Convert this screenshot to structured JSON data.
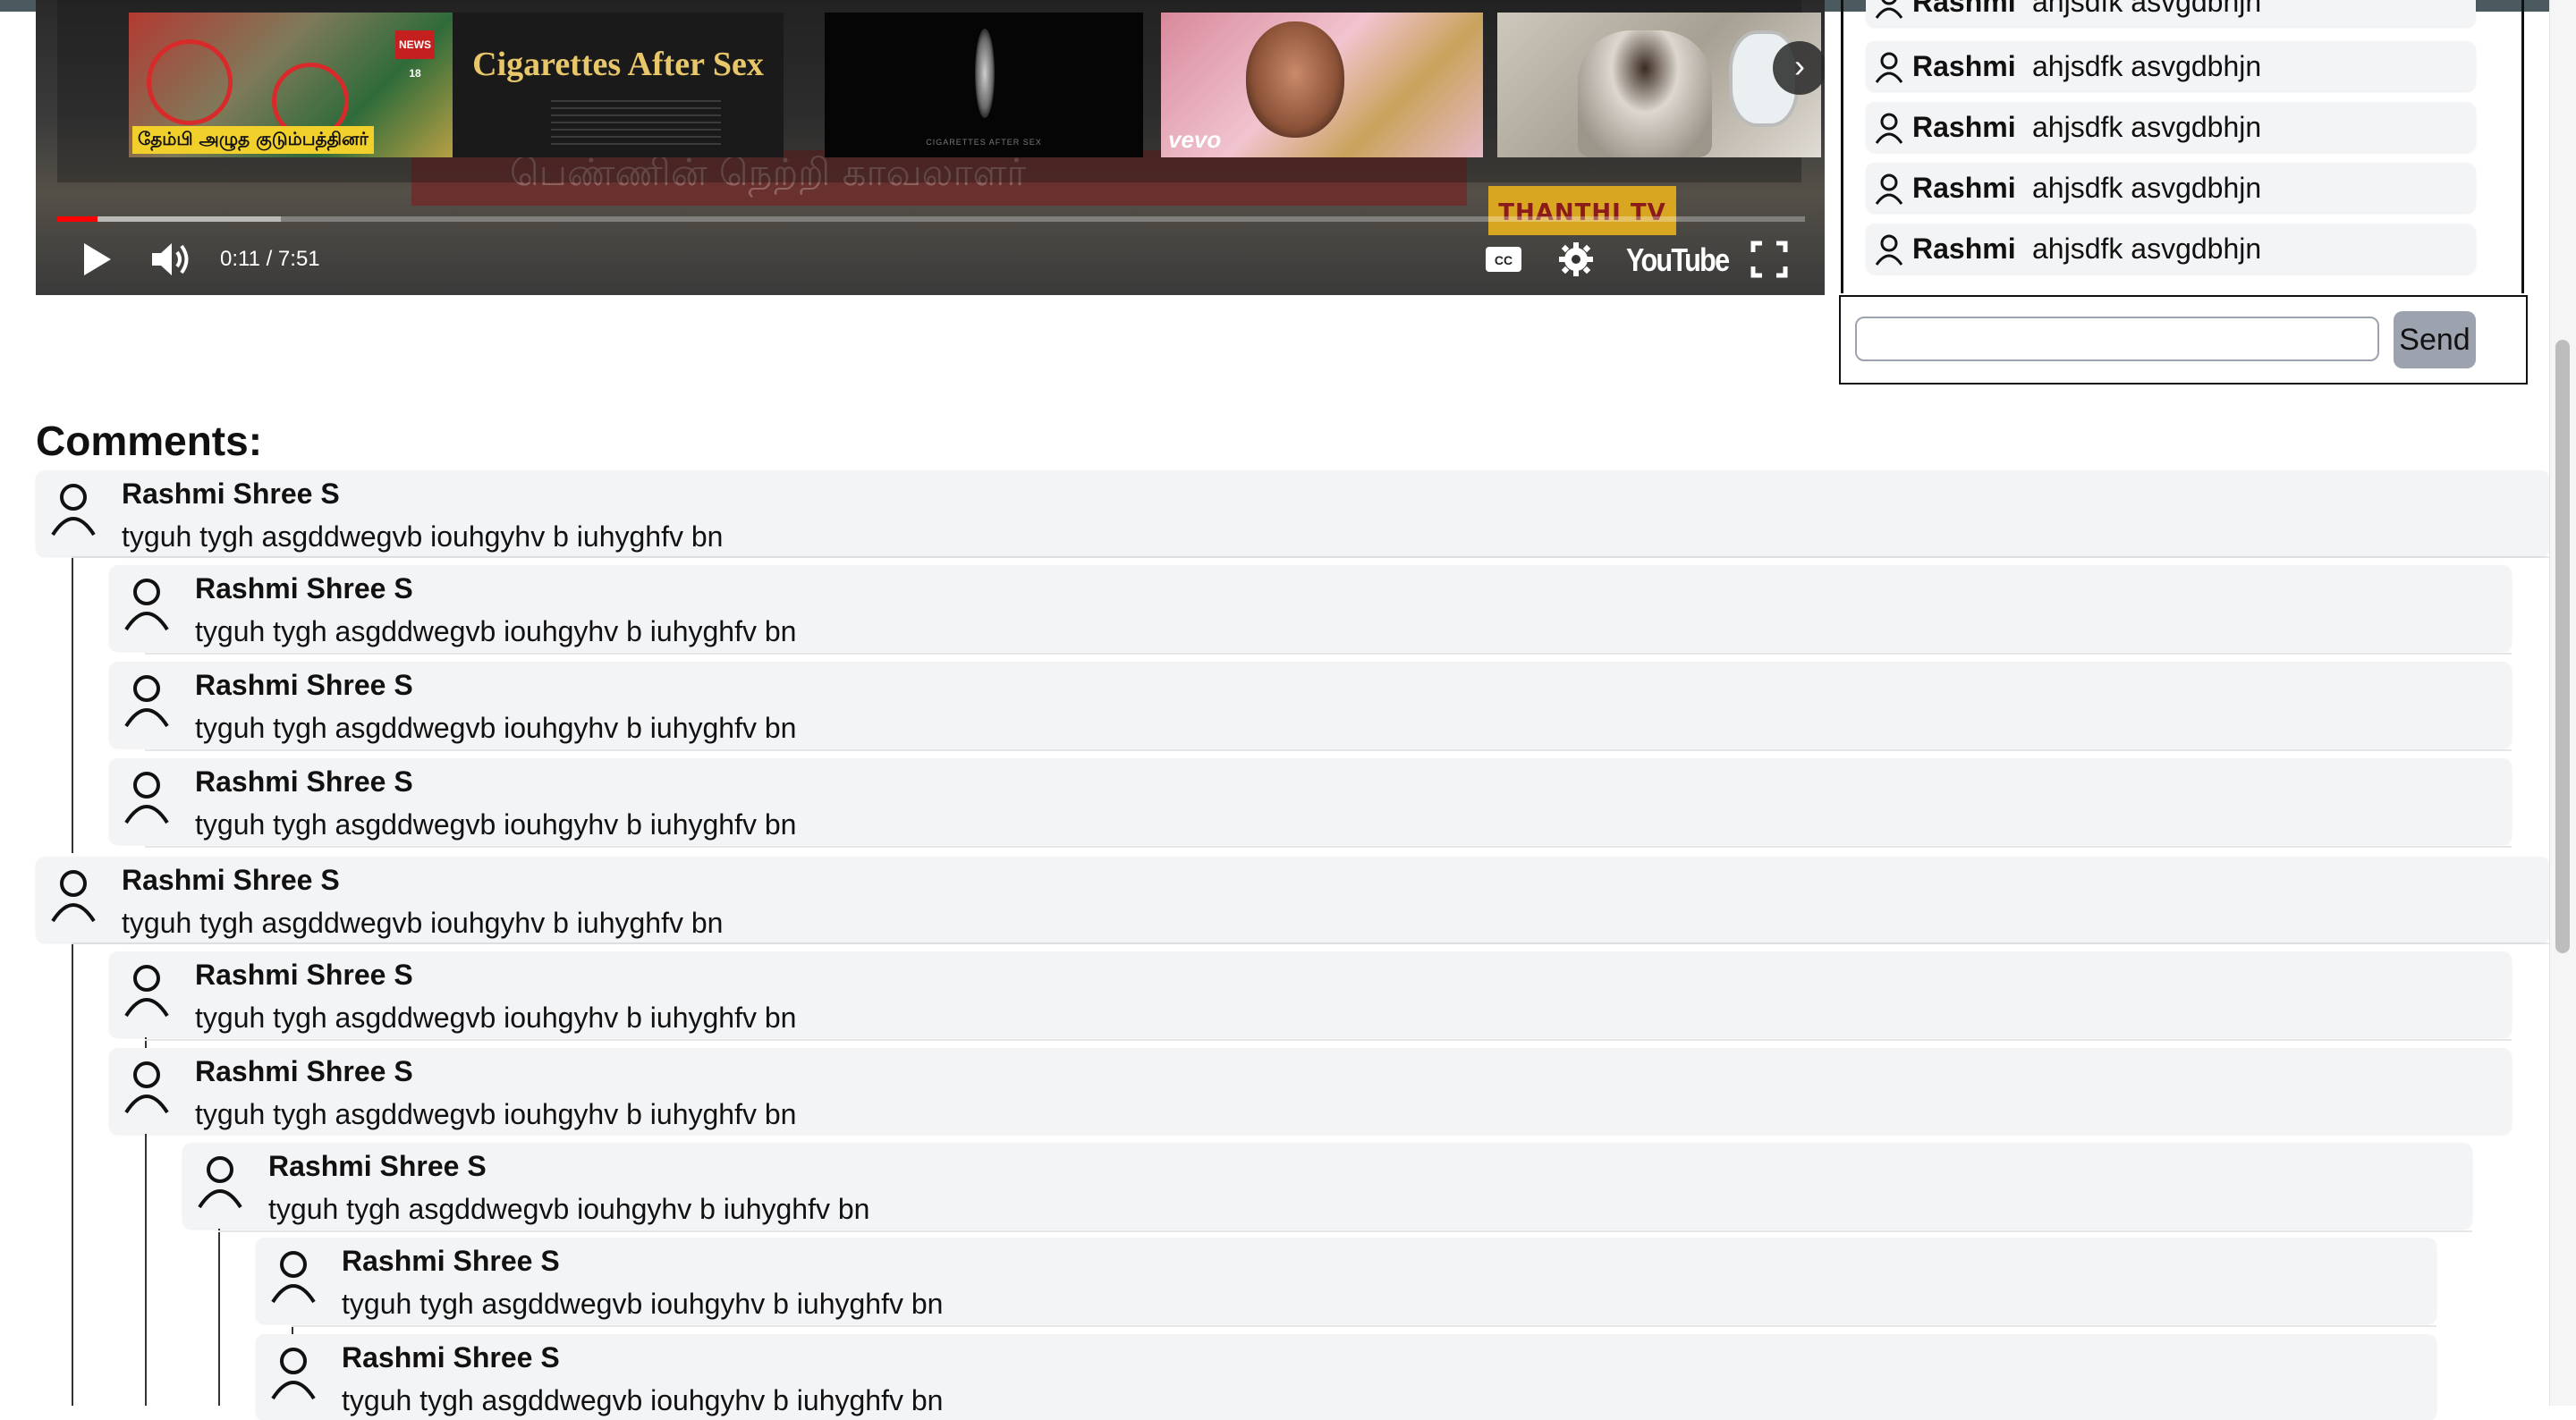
{
  "player": {
    "background_overlay_text": "பெண்ணின் நெற்றி காவலாளர்",
    "badge": "THANTHI TV",
    "endscreen": {
      "thumb1_label": "தேம்பி அழுத குடும்பத்தினர்",
      "thumb1_logo": "NEWS 18",
      "thumb2_title": "Cigarettes After Sex",
      "thumb3_caption": "CIGARETTES AFTER SEX",
      "thumb4_label": "vevo"
    },
    "progress_fraction": 0.023,
    "loaded_fraction": 0.128,
    "time_display": "0:11 / 7:51",
    "brand": "YouTube"
  },
  "chat": {
    "messages": [
      {
        "user": "Rashmi",
        "text": "ahjsdfk asvgdbhjn"
      },
      {
        "user": "Rashmi",
        "text": "ahjsdfk asvgdbhjn"
      },
      {
        "user": "Rashmi",
        "text": "ahjsdfk asvgdbhjn"
      },
      {
        "user": "Rashmi",
        "text": "ahjsdfk asvgdbhjn"
      },
      {
        "user": "Rashmi",
        "text": "ahjsdfk asvgdbhjn"
      }
    ],
    "input_value": "",
    "send_label": "Send"
  },
  "comments": {
    "title": "Comments:",
    "items": [
      {
        "author": "Rashmi Shree S",
        "text": "tyguh tygh asgddwegvb iouhgyhv b iuhyghfv bn"
      },
      {
        "author": "Rashmi Shree S",
        "text": "tyguh tygh asgddwegvb iouhgyhv b iuhyghfv bn"
      },
      {
        "author": "Rashmi Shree S",
        "text": "tyguh tygh asgddwegvb iouhgyhv b iuhyghfv bn"
      },
      {
        "author": "Rashmi Shree S",
        "text": "tyguh tygh asgddwegvb iouhgyhv b iuhyghfv bn"
      },
      {
        "author": "Rashmi Shree S",
        "text": "tyguh tygh asgddwegvb iouhgyhv b iuhyghfv bn"
      },
      {
        "author": "Rashmi Shree S",
        "text": "tyguh tygh asgddwegvb iouhgyhv b iuhyghfv bn"
      },
      {
        "author": "Rashmi Shree S",
        "text": "tyguh tygh asgddwegvb iouhgyhv b iuhyghfv bn"
      },
      {
        "author": "Rashmi Shree S",
        "text": "tyguh tygh asgddwegvb iouhgyhv b iuhyghfv bn"
      },
      {
        "author": "Rashmi Shree S",
        "text": "tyguh tygh asgddwegvb iouhgyhv b iuhyghfv bn"
      },
      {
        "author": "Rashmi Shree S",
        "text": "tyguh tygh asgddwegvb iouhgyhv b iuhyghfv bn"
      }
    ]
  }
}
